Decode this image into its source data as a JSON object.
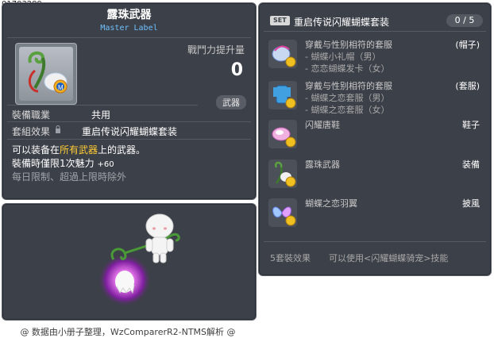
{
  "item_id": "01703289",
  "item": {
    "title": "露珠武器",
    "label": "Master Label",
    "power_label": "戰鬥力提升量",
    "power_value": "0",
    "category_badge": "武器",
    "job_label": "裝備職業",
    "job_value": "共用",
    "set_label": "套組效果",
    "set_value": "重启传说闪耀蝴蝶套装",
    "desc1_pre": "可以装备在",
    "desc1_highlight": "所有武器",
    "desc1_post": "上的武器。",
    "desc2_main": "裝備時僅限1次魅力",
    "desc2_charm": "+60",
    "desc3": "每日限制、超過上限時除外"
  },
  "credit": "@ 数据由小册子整理，WzComparerR2-NTMS解析 @",
  "set": {
    "badge": "SET",
    "title": "重启传说闪耀蝴蝶套装",
    "count": "0 / 5",
    "items": [
      {
        "name": "穿戴与性别相符的套服",
        "slot": "(帽子)",
        "sub": [
          "- 蝴蝶小礼帽（男）",
          "- 恋恋蝴蝶发卡（女）"
        ],
        "icon": "hat-icon"
      },
      {
        "name": "穿戴与性别相符的套服",
        "slot": "(套服)",
        "sub": [
          "- 蝴蝶之恋套服（男）",
          "- 蝴蝶之恋套服（女）"
        ],
        "icon": "outfit-icon"
      },
      {
        "name": "闪耀唐鞋",
        "slot": "鞋子",
        "sub": [],
        "icon": "shoes-icon"
      },
      {
        "name": "露珠武器",
        "slot": "装備",
        "sub": [],
        "icon": "weapon-icon"
      },
      {
        "name": "蝴蝶之恋羽翼",
        "slot": "披風",
        "sub": [],
        "icon": "wings-icon"
      }
    ],
    "effect_label": "5套裝效果",
    "effect_value": "可以使用<闪耀蝴蝶骑宠>技能"
  },
  "colors": {
    "panel_bg": "#3c4048",
    "label_blue": "#6ec0ff",
    "highlight_yellow": "#ffcc33"
  }
}
